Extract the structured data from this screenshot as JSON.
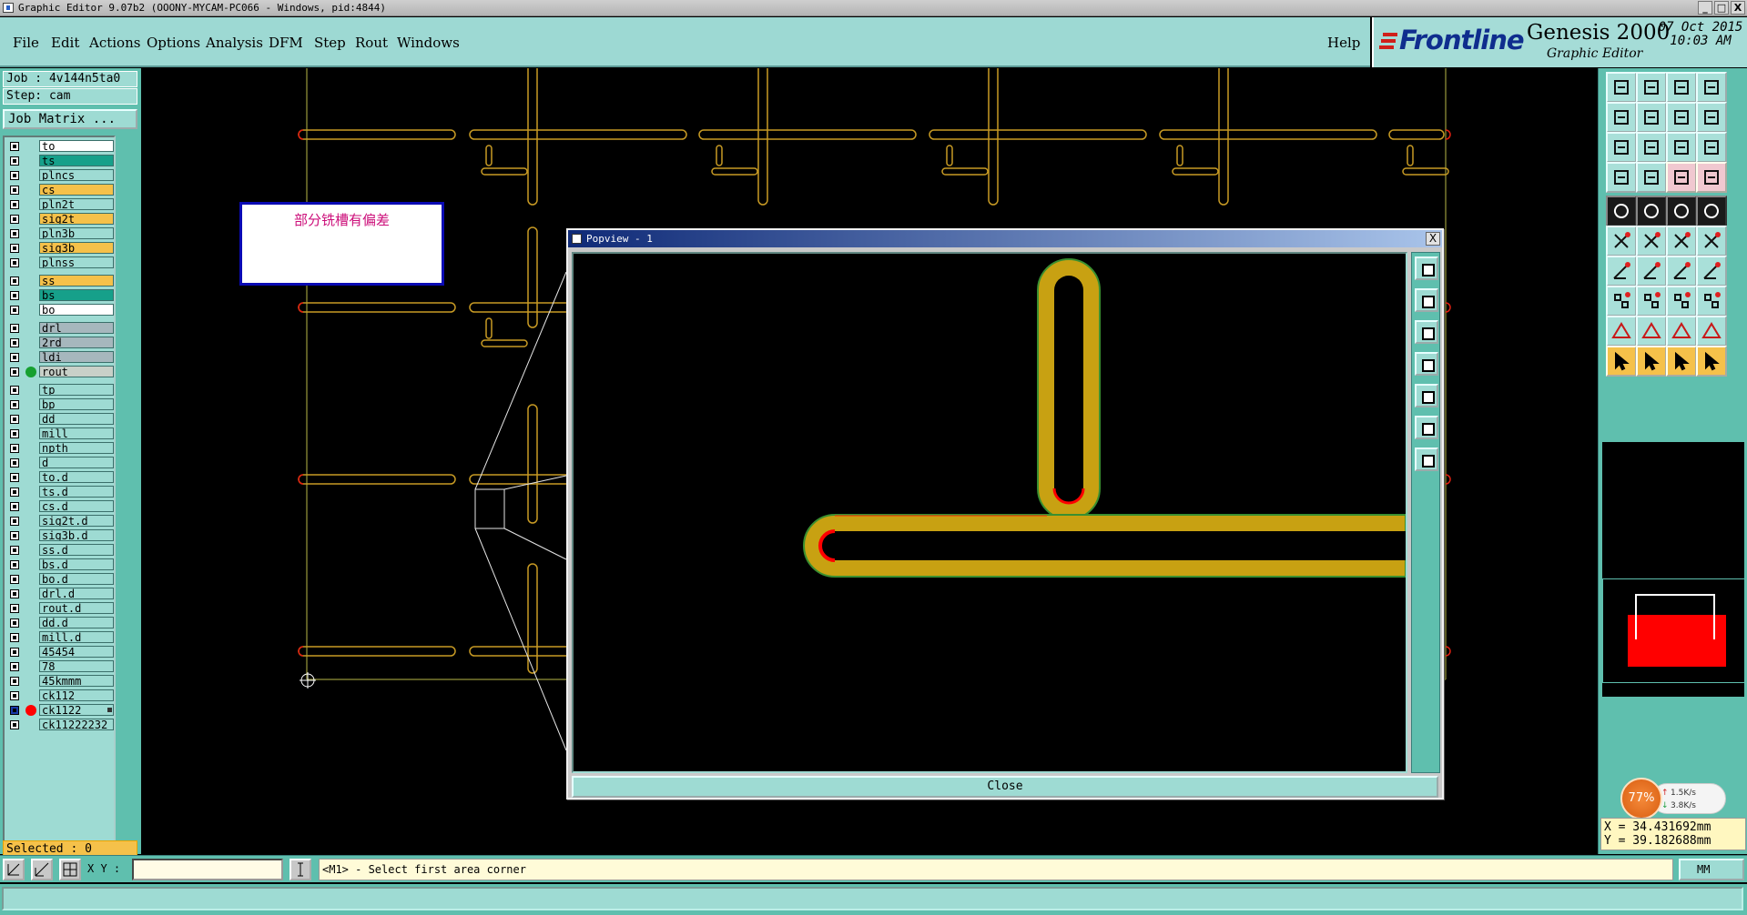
{
  "window": {
    "title": "Graphic Editor 9.07b2 (OOONY-MYCAM-PC066 - Windows, pid:4844)",
    "controls": [
      "_",
      "□",
      "X"
    ]
  },
  "menu": {
    "items": [
      "File",
      "Edit",
      "Actions",
      "Options",
      "Analysis",
      "DFM",
      "Step",
      "Rout",
      "Windows"
    ],
    "help": "Help"
  },
  "logo": {
    "brand": "Frontline",
    "product": "Genesis 2000",
    "subtitle": "Graphic Editor",
    "date": "07 Oct 2015",
    "time": "10:03 AM"
  },
  "job": {
    "job_line": "Job : 4v144n5ta0",
    "step_line": "Step: cam",
    "matrix_button": "Job Matrix ..."
  },
  "layers": [
    {
      "name": "to",
      "color": "#ffffff",
      "group": 0
    },
    {
      "name": "ts",
      "color": "#16a08a",
      "group": 0
    },
    {
      "name": "plncs",
      "color": "#9edbd3",
      "group": 0
    },
    {
      "name": "cs",
      "color": "#f5c14a",
      "group": 0
    },
    {
      "name": "pln2t",
      "color": "#9edbd3",
      "group": 0
    },
    {
      "name": "sig2t",
      "color": "#f5c14a",
      "group": 0
    },
    {
      "name": "pln3b",
      "color": "#9edbd3",
      "group": 0
    },
    {
      "name": "sig3b",
      "color": "#f5c14a",
      "group": 0
    },
    {
      "name": "plnss",
      "color": "#9edbd3",
      "group": 0
    },
    {
      "name": "ss",
      "color": "#f5c14a",
      "group": 1
    },
    {
      "name": "bs",
      "color": "#16a08a",
      "group": 1
    },
    {
      "name": "bo",
      "color": "#ffffff",
      "group": 1
    },
    {
      "name": "drl",
      "color": "#a6b7bd",
      "group": 2
    },
    {
      "name": "2rd",
      "color": "#a6b7bd",
      "group": 2
    },
    {
      "name": "ldi",
      "color": "#a6b7bd",
      "group": 2
    },
    {
      "name": "rout",
      "color": "#c8d0c8",
      "group": 2,
      "dot": "#16a030"
    },
    {
      "name": "tp",
      "color": "#9edbd3",
      "group": 3
    },
    {
      "name": "bp",
      "color": "#9edbd3",
      "group": 3
    },
    {
      "name": "dd",
      "color": "#9edbd3",
      "group": 3
    },
    {
      "name": "mill",
      "color": "#9edbd3",
      "group": 3
    },
    {
      "name": "npth",
      "color": "#9edbd3",
      "group": 3
    },
    {
      "name": "d",
      "color": "#9edbd3",
      "group": 3
    },
    {
      "name": "to.d",
      "color": "#9edbd3",
      "group": 3
    },
    {
      "name": "ts.d",
      "color": "#9edbd3",
      "group": 3
    },
    {
      "name": "cs.d",
      "color": "#9edbd3",
      "group": 3
    },
    {
      "name": "sig2t.d",
      "color": "#9edbd3",
      "group": 3
    },
    {
      "name": "sig3b.d",
      "color": "#9edbd3",
      "group": 3
    },
    {
      "name": "ss.d",
      "color": "#9edbd3",
      "group": 3
    },
    {
      "name": "bs.d",
      "color": "#9edbd3",
      "group": 3
    },
    {
      "name": "bo.d",
      "color": "#9edbd3",
      "group": 3
    },
    {
      "name": "drl.d",
      "color": "#9edbd3",
      "group": 3
    },
    {
      "name": "rout.d",
      "color": "#9edbd3",
      "group": 3
    },
    {
      "name": "dd.d",
      "color": "#9edbd3",
      "group": 3
    },
    {
      "name": "mill.d",
      "color": "#9edbd3",
      "group": 3
    },
    {
      "name": "45454",
      "color": "#9edbd3",
      "group": 3
    },
    {
      "name": "78",
      "color": "#9edbd3",
      "group": 3
    },
    {
      "name": "45kmmm",
      "color": "#9edbd3",
      "group": 3
    },
    {
      "name": "ck112",
      "color": "#9edbd3",
      "group": 3
    },
    {
      "name": "ck1122",
      "color": "#9edbd3",
      "group": 3,
      "dot": "#ff0000",
      "blue": true,
      "mark": true
    },
    {
      "name": "ck11222232",
      "color": "#9edbd3",
      "group": 3
    }
  ],
  "selected": "Selected : 0",
  "note": "部分铣槽有偏差",
  "popview": {
    "title": "Popview - 1",
    "close_x": "X",
    "close_button": "Close"
  },
  "netspeed": {
    "percent": "77%",
    "up": "1.5K/s",
    "down": "3.8K/s",
    "up_arrow": "↑",
    "down_arrow": "↓"
  },
  "coords": {
    "x": "X = 34.431692mm",
    "y": "Y = 39.182688mm"
  },
  "bottom": {
    "xy_label": "X Y :",
    "xy_value": "",
    "message": "<M1> - Select first area corner",
    "units": "MM"
  },
  "colors": {
    "panel": "#5fbfae",
    "field": "#9edbd3",
    "menubar": "#9dd9d3",
    "outline": "#c79a24",
    "rout_fill": "#c8a112",
    "highlight": "#ff0000"
  }
}
